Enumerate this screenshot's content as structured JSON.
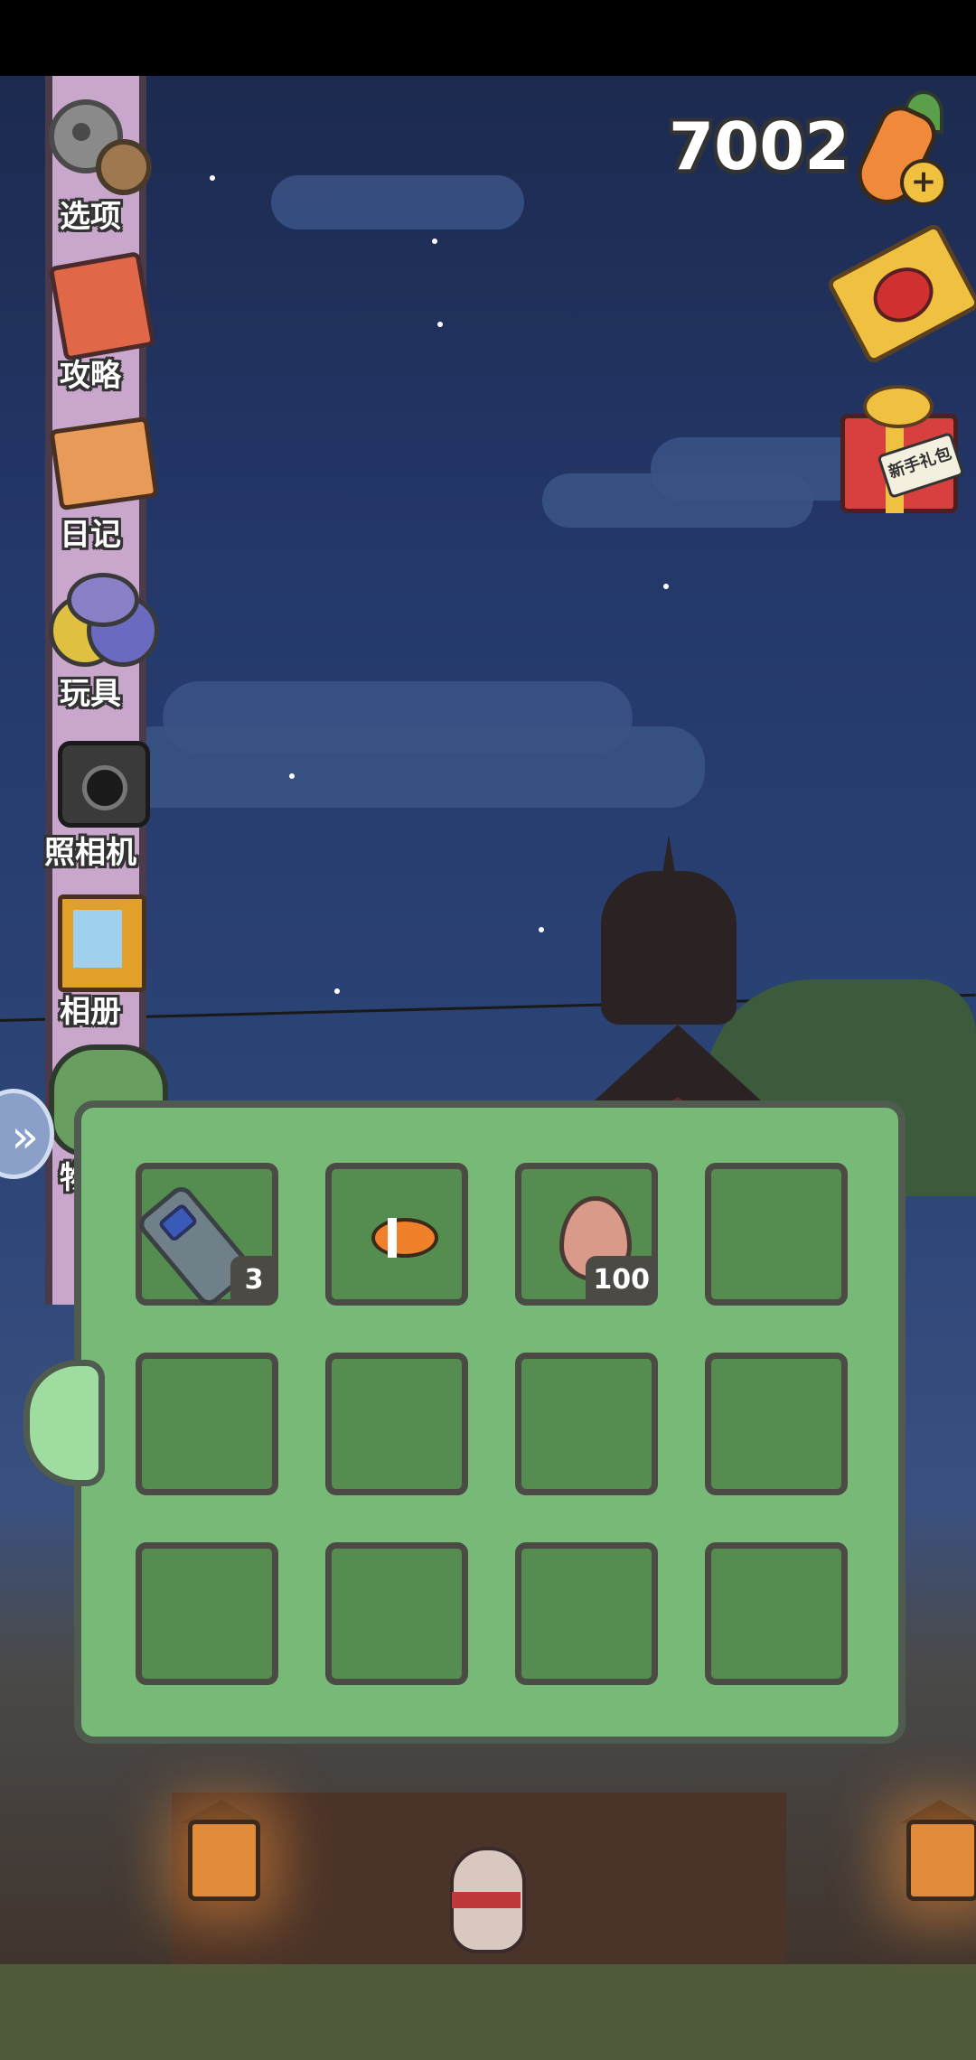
{
  "hud": {
    "currency_amount": "7002",
    "carrot_icon": "carrot-plus-icon",
    "gift_tag_text": "新手礼包"
  },
  "sidebar": {
    "items": [
      {
        "label": "选项",
        "icon": "settings-gear-icon"
      },
      {
        "label": "攻略",
        "icon": "guide-book-icon"
      },
      {
        "label": "日记",
        "icon": "diary-icon"
      },
      {
        "label": "玩具",
        "icon": "toys-icon"
      },
      {
        "label": "照相机",
        "icon": "camera-icon"
      },
      {
        "label": "相册",
        "icon": "photo-album-icon"
      },
      {
        "label": "物品",
        "icon": "backpack-icon"
      }
    ]
  },
  "inventory": {
    "slots": [
      {
        "item": "plastic-bottle",
        "quantity": "3"
      },
      {
        "item": "clownfish",
        "quantity": ""
      },
      {
        "item": "egg",
        "quantity": "100"
      },
      {
        "item": "",
        "quantity": ""
      },
      {
        "item": "",
        "quantity": ""
      },
      {
        "item": "",
        "quantity": ""
      },
      {
        "item": "",
        "quantity": ""
      },
      {
        "item": "",
        "quantity": ""
      },
      {
        "item": "",
        "quantity": ""
      },
      {
        "item": "",
        "quantity": ""
      },
      {
        "item": "",
        "quantity": ""
      },
      {
        "item": "",
        "quantity": ""
      }
    ]
  },
  "colors": {
    "panel_bg": "#77b976",
    "slot_bg": "#548d4f",
    "outline": "#4c4a44",
    "sidebar_pole": "#c9a6cc"
  }
}
